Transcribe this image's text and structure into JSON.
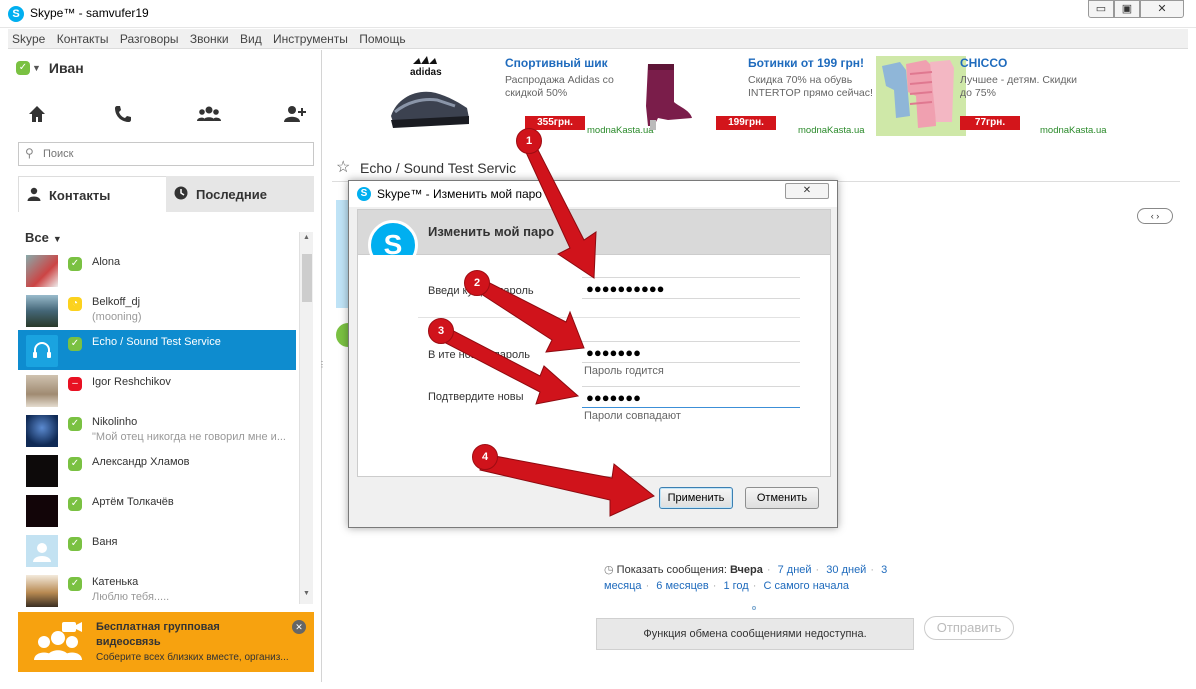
{
  "window": {
    "title": "Skype™ - samvufer19",
    "min_glyph": "▭",
    "max_glyph": "▣",
    "close_glyph": "✕"
  },
  "menu": [
    "Skype",
    "Контакты",
    "Разговоры",
    "Звонки",
    "Вид",
    "Инструменты",
    "Помощь"
  ],
  "user": {
    "name": "Иван",
    "status_icon": "check-icon"
  },
  "search": {
    "placeholder": "Поиск"
  },
  "tabs": {
    "contacts": "Контакты",
    "recent": "Последние"
  },
  "filter": {
    "label": "Все"
  },
  "contacts": [
    {
      "name": "Alona",
      "mood": "",
      "status": "online"
    },
    {
      "name": "Belkoff_dj",
      "mood": "(mooning)",
      "status": "away"
    },
    {
      "name": "Echo / Sound Test Service",
      "mood": "",
      "status": "online",
      "selected": true
    },
    {
      "name": "Igor Reshchikov",
      "mood": "",
      "status": "busy"
    },
    {
      "name": "Nikolinho",
      "mood": "\"Мой отец никогда не говорил мне и...",
      "status": "online"
    },
    {
      "name": "Александр Хламов",
      "mood": "",
      "status": "online"
    },
    {
      "name": "Артём Толкачёв",
      "mood": "",
      "status": "online"
    },
    {
      "name": "Ваня",
      "mood": "",
      "status": "online"
    },
    {
      "name": "Катенька",
      "mood": "Люблю тебя.....",
      "status": "online"
    }
  ],
  "promo": {
    "title_line1": "Бесплатная групповая",
    "title_line2": "видеосвязь",
    "text": "Соберите всех близких вместе, организ..."
  },
  "ads": [
    {
      "title": "Спортивный шик",
      "desc": "Распродажа Adidas со скидкой 50%",
      "price": "355грн.",
      "site": "modnaKasta.ua",
      "brand": "adidas"
    },
    {
      "title": "Ботинки от 199 грн!",
      "desc": "Скидка 70% на обувь INTERTOP прямо сейчас!",
      "price": "199грн.",
      "site": "modnaKasta.ua"
    },
    {
      "title": "CHICCO",
      "desc": "Лучшее - детям. Скидки до 75%",
      "price": "77грн.",
      "site": "modnaKasta.ua"
    }
  ],
  "conversation": {
    "name": "Echo / Sound Test Servic"
  },
  "history": {
    "prefix": "Показать сообщения:",
    "current": "Вчера",
    "links": [
      "7 дней",
      "30 дней",
      "3 месяца",
      "6 месяцев",
      "1 год",
      "С самого начала"
    ]
  },
  "messaging": {
    "unavailable": "Функция обмена сообщениями недоступна.",
    "send": "Отправить"
  },
  "dialog": {
    "title": "Skype™ - Изменить мой паро",
    "header": "Изменить мой паро",
    "close_glyph": "✕",
    "current_label": "Введи      кущий пароль",
    "current_value": "●●●●●●●●●●",
    "new_label": "В      ите новый пароль",
    "new_value": "●●●●●●●",
    "new_hint": "Пароль годится",
    "confirm_label": "Подтвердите новы",
    "confirm_value": "●●●●●●●",
    "confirm_hint": "Пароли совпадают",
    "apply": "Применить",
    "cancel": "Отменить"
  },
  "badges": [
    "1",
    "2",
    "3",
    "4"
  ],
  "colors": {
    "skype_blue": "#00aff0",
    "selected_row": "#0e8ccf",
    "online": "#7ac142",
    "away": "#fcd21e",
    "busy": "#e81123",
    "promo": "#f7a20f",
    "arrow_red": "#d0131b"
  }
}
